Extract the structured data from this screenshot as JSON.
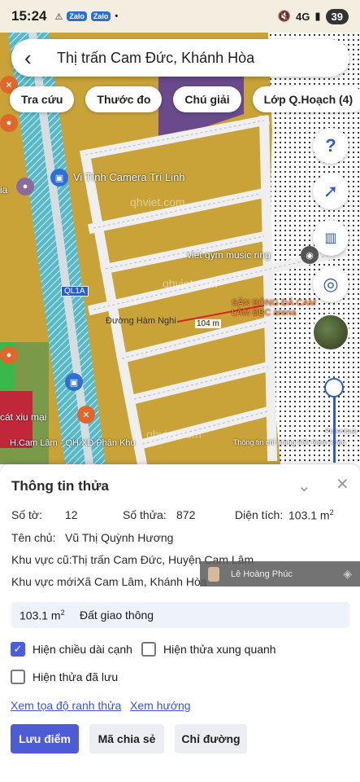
{
  "status_bar": {
    "time": "15:24",
    "notif_icons": [
      "warning-icon",
      "Zalo",
      "Zalo",
      "dot"
    ],
    "signal": "4G",
    "battery": "39"
  },
  "search": {
    "back_icon": "back-arrow-icon",
    "title": "Thị trấn Cam Đức, Khánh Hòa"
  },
  "chips": [
    "Tra cứu",
    "Thước đo",
    "Chú giải",
    "Lớp Q.Hoạch (4)"
  ],
  "map": {
    "watermarks": [
      "qhviet.com",
      "qhviet.com",
      "qhviet.com"
    ],
    "road_tag": "QL1A",
    "dimension_label": "104 m",
    "poi_labels": [
      "Vi Tính Camera Trí Linh",
      "viet gym music ring",
      "SÂN BÓNG ĐÁ CAM LÂM BBC arena",
      "Đường Hàm Nghi",
      "cát xiu mại",
      "ia"
    ],
    "bottom_left": "H.Cam Lâm - QH XD Phân Khu",
    "bottom_right": "Thông tin chỉ mang tính tham khảo",
    "attribution": "Philembuai",
    "colors": {
      "land": "#c9a338",
      "road": "#f2f2f2",
      "highway": "#58b9c9",
      "park": "#63a45a",
      "dotted": "#ffffff"
    }
  },
  "panel": {
    "title": "Thông tin thửa",
    "so_to_label": "Số tờ:",
    "so_to": "12",
    "so_thua_label": "Số thửa:",
    "so_thua": "872",
    "dien_tich_label": "Diện tích:",
    "dien_tich": "103.1 m",
    "dien_tich_unit_sup": "2",
    "ten_chu_label": "Tên chủ:",
    "ten_chu": "Vũ Thị Quỳnh Hương",
    "khu_vuc_cu_label": "Khu vực cũ:",
    "khu_vuc_cu": "Thị trấn Cam Đức, Huyện Cam Lâm",
    "khu_vuc_moi_label": "Khu vực mới:",
    "khu_vuc_moi": "Xã Cam Lâm, Khánh Hòa",
    "overlay_user": "Lê Hoàng Phúc",
    "land_area": "103.1 m",
    "land_area_sup": "2",
    "land_type": "Đất giao thông",
    "checkboxes": [
      {
        "label": "Hiện chiều dài cạnh",
        "checked": true
      },
      {
        "label": "Hiện thửa xung quanh",
        "checked": false
      },
      {
        "label": "Hiện thửa đã lưu",
        "checked": false
      }
    ],
    "links": [
      "Xem tọa độ ranh thửa",
      "Xem hướng"
    ],
    "buttons": [
      "Lưu điểm",
      "Mã chia sẻ",
      "Chỉ đường"
    ]
  }
}
